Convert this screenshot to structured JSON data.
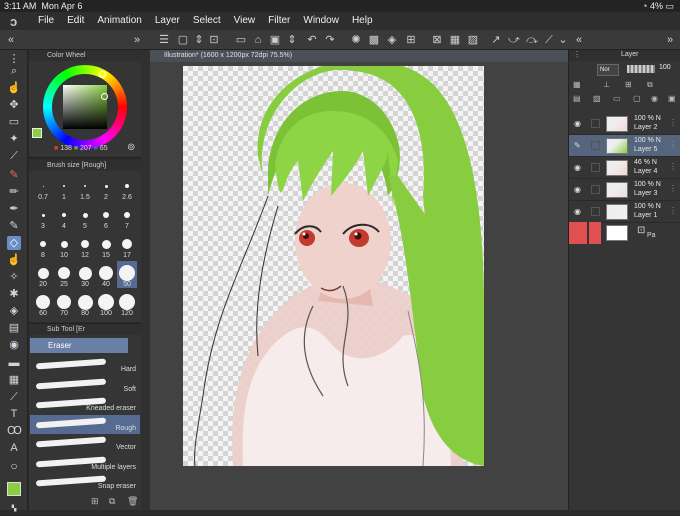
{
  "status": {
    "time": "3:11 AM",
    "date": "Mon Apr 6",
    "battery": "4%"
  },
  "menu": [
    "File",
    "Edit",
    "Animation",
    "Layer",
    "Select",
    "View",
    "Filter",
    "Window",
    "Help"
  ],
  "color_wheel": {
    "title": "Color Wheel",
    "r": "138",
    "g": "207",
    "b": "65",
    "current_color": "#8acf41"
  },
  "brush_size": {
    "title": "Brush size [Rough]",
    "sizes": [
      "0.7",
      "1",
      "1.5",
      "2",
      "2.6",
      "3",
      "4",
      "5",
      "6",
      "7",
      "8",
      "10",
      "12",
      "15",
      "17",
      "20",
      "25",
      "30",
      "40",
      "50",
      "60",
      "70",
      "80",
      "100",
      "120"
    ],
    "selected": "50"
  },
  "sub_tool": {
    "title": "Sub Tool [Er",
    "group": "Eraser",
    "items": [
      "Hard",
      "Soft",
      "Kneaded eraser",
      "Rough",
      "Vector",
      "Multiple layers",
      "Snap eraser"
    ],
    "selected": "Rough"
  },
  "document": {
    "tab": "Illustration* (1600 x 1200px 72dpi 75.5%)"
  },
  "layer_panel": {
    "title": "Layer",
    "blend": "Nor",
    "opacity": "100",
    "layers": [
      {
        "opacity": "100 % N",
        "name": "Layer 2",
        "selected": false
      },
      {
        "opacity": "100 % N",
        "name": "Layer 5",
        "selected": true
      },
      {
        "opacity": "46 % N",
        "name": "Layer 4",
        "selected": false
      },
      {
        "opacity": "100 % N",
        "name": "Layer 3",
        "selected": false
      },
      {
        "opacity": "100 % N",
        "name": "Layer 1",
        "selected": false
      }
    ],
    "paper_label": "Pa"
  },
  "colors": {
    "accent": "#6a8fc7",
    "hair": "#8acf41",
    "selected_row": "#55657d"
  }
}
